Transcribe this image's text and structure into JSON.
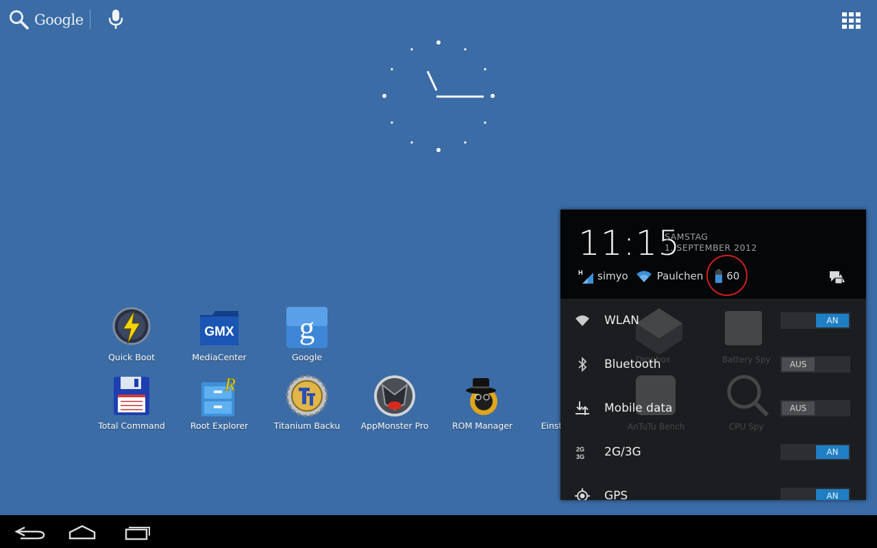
{
  "search": {
    "logo": "Google",
    "icons": [
      "search-icon",
      "mic-icon"
    ]
  },
  "apps_button": {
    "icon": "apps-grid-icon"
  },
  "home_apps": [
    {
      "label": "Quick Boot",
      "icon": "quick-boot-icon"
    },
    {
      "label": "MediaCenter",
      "icon": "gmx-icon",
      "icon_text": "GMX"
    },
    {
      "label": "Google",
      "icon": "google-icon",
      "icon_text": "g"
    },
    {
      "label": "Total Command",
      "icon": "floppy-icon"
    },
    {
      "label": "Root Explorer",
      "icon": "root-explorer-icon"
    },
    {
      "label": "Titanium Backu",
      "icon": "titanium-icon"
    },
    {
      "label": "AppMonster Pro",
      "icon": "appmonster-icon"
    },
    {
      "label": "ROM Manager",
      "icon": "rom-manager-icon"
    },
    {
      "label": "Einstellungen",
      "icon": "settings-icon"
    }
  ],
  "notification_panel": {
    "time": "11:15",
    "day": "SAMSTAG",
    "date": "1. SEPTEMBER 2012",
    "carrier": "simyo",
    "network_type": "H",
    "wifi_name": "Paulchen",
    "battery": "60",
    "quick_settings": [
      {
        "label": "WLAN",
        "state": "AN",
        "on": true,
        "icon": "wifi-icon"
      },
      {
        "label": "Bluetooth",
        "state": "AUS",
        "on": false,
        "icon": "bluetooth-icon"
      },
      {
        "label": "Mobile data",
        "state": "AUS",
        "on": false,
        "icon": "mobile-data-icon"
      },
      {
        "label": "2G/3G",
        "state": "AN",
        "on": true,
        "icon": "2g-3g-icon"
      },
      {
        "label": "GPS",
        "state": "AN",
        "on": true,
        "icon": "gps-icon"
      }
    ]
  },
  "background_apps": [
    "Dropbox",
    "Battery Spy",
    "AnTuTu Bench",
    "CPU Spy"
  ],
  "navbar": {
    "icons": [
      "back-icon",
      "home-icon",
      "recent-apps-icon"
    ]
  },
  "colors": {
    "wallpaper": "#3b6ca6",
    "toggle_on": "#1f7fc4",
    "highlight_circle": "#d0201d"
  }
}
